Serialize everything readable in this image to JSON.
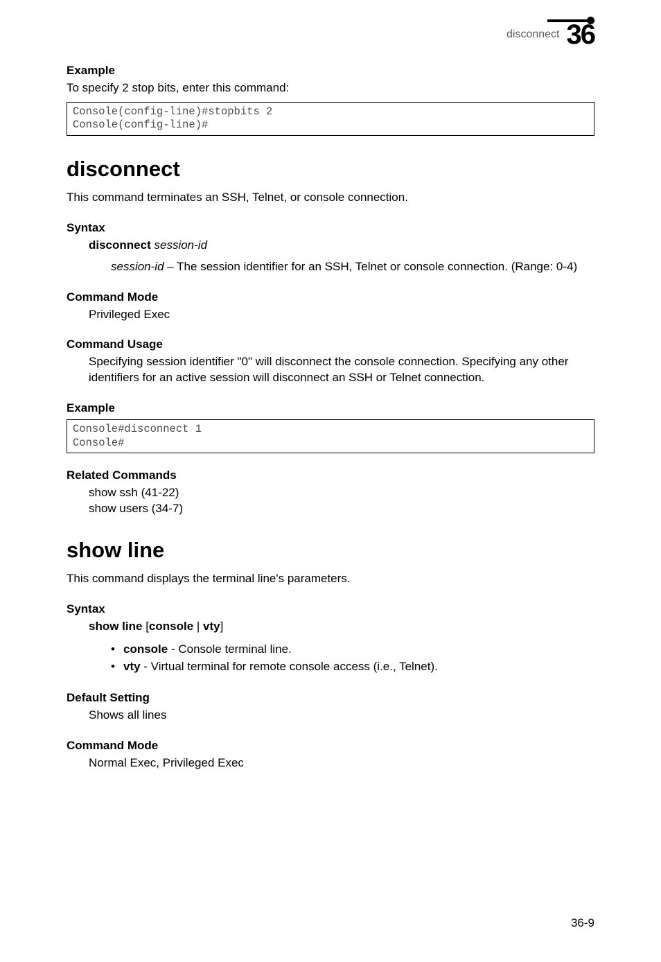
{
  "header": {
    "running_title": "disconnect",
    "chapter_number": "36"
  },
  "intro": {
    "example_label": "Example",
    "example_text": "To specify 2 stop bits, enter this command:",
    "code_line1": "Console(config-line)#stopbits 2",
    "code_line2": "Console(config-line)#"
  },
  "disconnect": {
    "heading": "disconnect",
    "desc": "This command terminates an SSH, Telnet, or console connection.",
    "syntax_label": "Syntax",
    "syntax_cmd_bold": "disconnect",
    "syntax_cmd_italic": "session-id",
    "syntax_param_italic": "session-id",
    "syntax_param_rest": " – The session identifier for an SSH, Telnet or console connection. (Range: 0-4)",
    "mode_label": "Command Mode",
    "mode_text": "Privileged Exec",
    "usage_label": "Command Usage",
    "usage_text": "Specifying session identifier \"0\" will disconnect the console connection. Specifying any other identifiers for an active session will disconnect an SSH or Telnet connection.",
    "example_label": "Example",
    "code_line1": "Console#disconnect 1",
    "code_line2": "Console#",
    "related_label": "Related Commands",
    "related_line1": "show ssh (41-22)",
    "related_line2": "show users (34-7)"
  },
  "showline": {
    "heading": "show line",
    "desc": "This command displays the terminal line's parameters.",
    "syntax_label": "Syntax",
    "syntax_show": "show line",
    "syntax_open": " [",
    "syntax_console": "console",
    "syntax_pipe": " | ",
    "syntax_vty": "vty",
    "syntax_close": "]",
    "bullet1_bold": "console",
    "bullet1_rest": " - Console terminal line.",
    "bullet2_bold": "vty",
    "bullet2_rest": " - Virtual terminal for remote console access (i.e., Telnet).",
    "default_label": "Default Setting",
    "default_text": "Shows all lines",
    "mode_label": "Command Mode",
    "mode_text": "Normal Exec, Privileged Exec"
  },
  "footer": {
    "page_number": "36-9"
  }
}
